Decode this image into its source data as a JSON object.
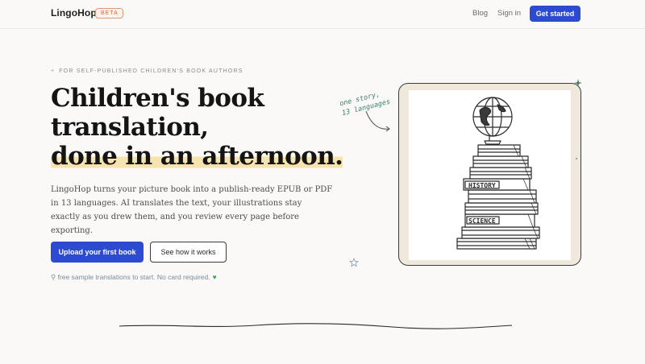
{
  "nav": {
    "brand": "LingoHop",
    "badge": "BETA",
    "links": [
      "Blog",
      "Sign in"
    ],
    "cta": "Get started"
  },
  "hero": {
    "eyebrow": "FOR SELF-PUBLISHED CHILDREN'S BOOK AUTHORS",
    "headline_lines": [
      "Children's book",
      "translation,",
      "done in an afternoon."
    ],
    "subtext": "LingoHop turns your picture book into a publish-ready EPUB or PDF in 13 languages. AI translates the text, your illustrations stay exactly as you drew them, and you review every page before exporting.",
    "primary_button": "Upload your first book",
    "secondary_button": "See how it works",
    "note": "free sample translations to start. No card required."
  },
  "illustration": {
    "scribble_lines": [
      "one story,",
      "13 languages"
    ],
    "book_labels": [
      "HISTORY",
      "SCIENCE"
    ]
  },
  "colors": {
    "accent": "#2c4bd0",
    "highlight": "#f7e3b0",
    "badge": "#d2683a",
    "scribble": "#3e7d6d"
  }
}
